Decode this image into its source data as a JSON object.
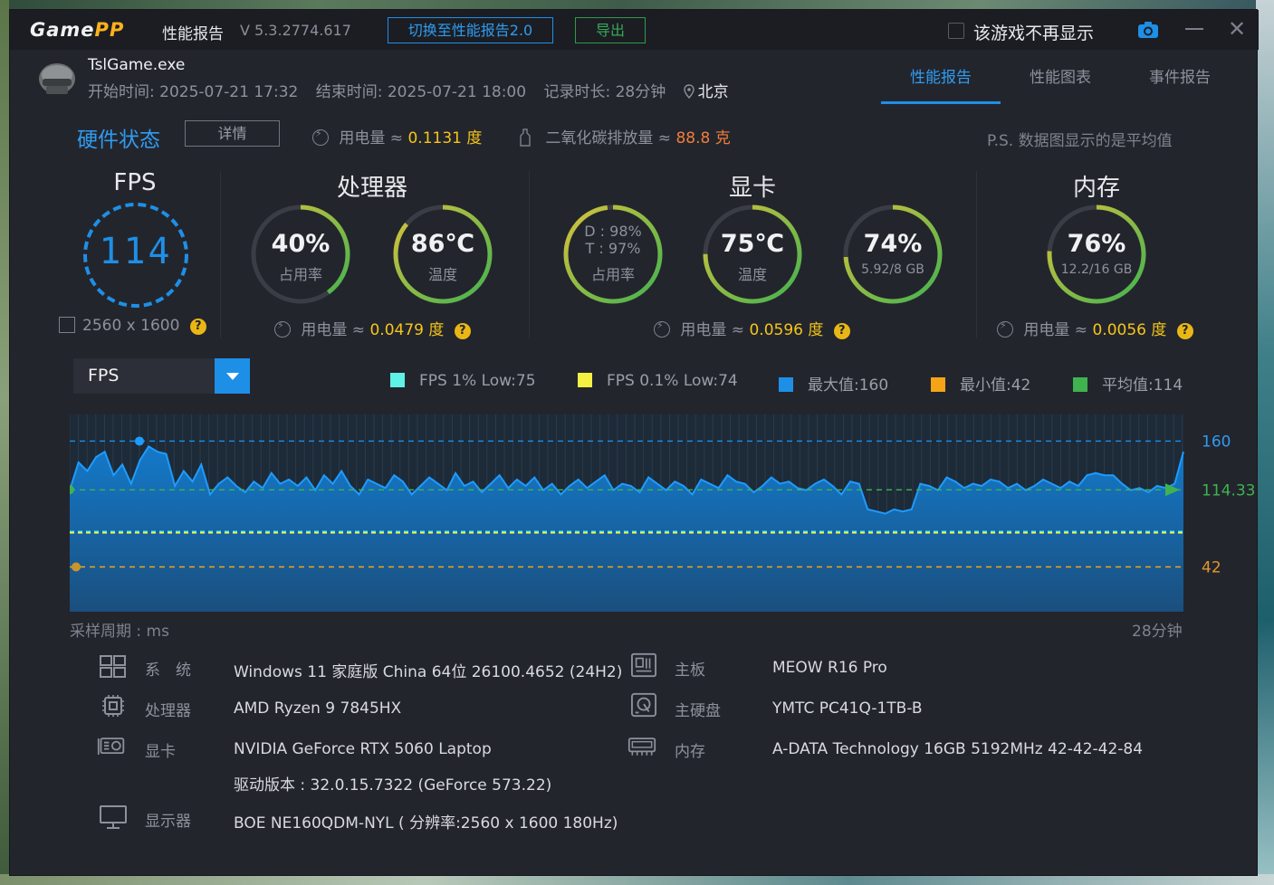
{
  "app": {
    "logo_main": "Game",
    "logo_accent": "PP",
    "name": "性能报告",
    "version": "V 5.3.2774.617",
    "switch_label": "切换至性能报告2.0",
    "export_label": "导出",
    "dont_show_label": "该游戏不再显示"
  },
  "game": {
    "exe": "TslGame.exe",
    "start": "开始时间: 2025-07-21 17:32",
    "end": "结束时间: 2025-07-21 18:00",
    "duration": "记录时长: 28分钟",
    "city": "北京"
  },
  "tabs": [
    {
      "label": "性能报告",
      "active": true
    },
    {
      "label": "性能图表",
      "active": false
    },
    {
      "label": "事件报告",
      "active": false
    }
  ],
  "hardware": {
    "title": "硬件状态",
    "detail_label": "详情",
    "power_label": "用电量 ≈",
    "power_value": "0.1131 度",
    "co2_label": "二氧化碳排放量 ≈",
    "co2_value": "88.8 克",
    "note": "P.S. 数据图显示的是平均值"
  },
  "fps": {
    "title": "FPS",
    "value": "114",
    "resolution": "2560 x 1600"
  },
  "cpu": {
    "title": "处理器",
    "usage_value": "40%",
    "usage_label": "占用率",
    "usage_fraction": 0.4,
    "temp_value": "86℃",
    "temp_label": "温度",
    "temp_fraction": 0.86,
    "power_label": "用电量 ≈",
    "power_value": "0.0479 度"
  },
  "gpu": {
    "title": "显卡",
    "usage_d": "D : 98%",
    "usage_t": "T : 97%",
    "usage_label": "占用率",
    "usage_fraction": 0.98,
    "temp_value": "75℃",
    "temp_label": "温度",
    "temp_fraction": 0.75,
    "vram_value": "74%",
    "vram_detail": "5.92/8 GB",
    "vram_fraction": 0.74,
    "power_label": "用电量 ≈",
    "power_value": "0.0596 度"
  },
  "memory": {
    "title": "内存",
    "usage_value": "76%",
    "usage_detail": "12.2/16 GB",
    "usage_fraction": 0.76,
    "power_label": "用电量 ≈",
    "power_value": "0.0056 度"
  },
  "chart_controls": {
    "selected_metric": "FPS"
  },
  "legend": [
    {
      "label": "FPS 1% Low:75",
      "color": "#5ff2e6"
    },
    {
      "label": "FPS 0.1% Low:74",
      "color": "#f5f042"
    },
    {
      "label": "最大值:160",
      "color": "#1e8fe6"
    },
    {
      "label": "最小值:42",
      "color": "#f5a418"
    },
    {
      "label": "平均值:114",
      "color": "#3fb34f"
    }
  ],
  "chart_data": {
    "type": "area",
    "x_start_label": "采样周期 : ms",
    "x_end_label": "28分钟",
    "ylim": [
      0,
      185
    ],
    "max": 160,
    "min": 42,
    "avg": 114.33,
    "low_1pct": 75,
    "low_01pct": 74,
    "max_label": "160",
    "min_label": "42",
    "avg_label": "114.33",
    "series": [
      {
        "values": [
          114,
          140,
          132,
          145,
          150,
          128,
          138,
          120,
          142,
          155,
          150,
          148,
          118,
          132,
          122,
          138,
          110,
          120,
          126,
          118,
          112,
          122,
          116,
          130,
          120,
          124,
          118,
          126,
          114,
          128,
          120,
          132,
          118,
          110,
          124,
          120,
          116,
          128,
          122,
          110,
          118,
          126,
          120,
          114,
          130,
          118,
          122,
          112,
          120,
          128,
          116,
          124,
          118,
          126,
          114,
          120,
          110,
          118,
          124,
          116,
          122,
          128,
          114,
          120,
          118,
          112,
          126,
          120,
          114,
          122,
          118,
          110,
          124,
          120,
          116,
          128,
          122,
          120,
          112,
          118,
          126,
          120,
          122,
          116,
          114,
          120,
          124,
          118,
          110,
          122,
          120,
          96,
          94,
          92,
          96,
          94,
          96,
          120,
          118,
          114,
          126,
          122,
          116,
          120,
          118,
          124,
          122,
          116,
          120,
          114,
          118,
          124,
          120,
          116,
          122,
          118,
          128,
          130,
          128,
          128,
          120,
          114,
          116,
          112,
          118,
          116,
          120,
          150
        ]
      }
    ]
  },
  "system": {
    "os_label": "系　统",
    "os_value": "Windows 11 家庭版 China 64位 26100.4652 (24H2)",
    "cpu_label": "处理器",
    "cpu_value": "AMD Ryzen 9 7845HX",
    "gpu_label": "显卡",
    "gpu_value": "NVIDIA GeForce RTX 5060 Laptop",
    "driver_value": "驱动版本 : 32.0.15.7322 (GeForce 573.22)",
    "monitor_label": "显示器",
    "monitor_value": "BOE NE160QDM-NYL ( 分辨率:2560 x 1600 180Hz)",
    "board_label": "主板",
    "board_value": "MEOW R16 Pro",
    "disk_label": "主硬盘",
    "disk_value": "YMTC PC41Q-1TB-B",
    "ram_label": "内存",
    "ram_value": "A-DATA Technology 16GB 5192MHz 42-42-42-84"
  },
  "colors": {
    "accent": "#1e8fe6",
    "ring_start": "#3fb34f",
    "ring_end": "#d9c23a",
    "track": "#3a3d45"
  }
}
